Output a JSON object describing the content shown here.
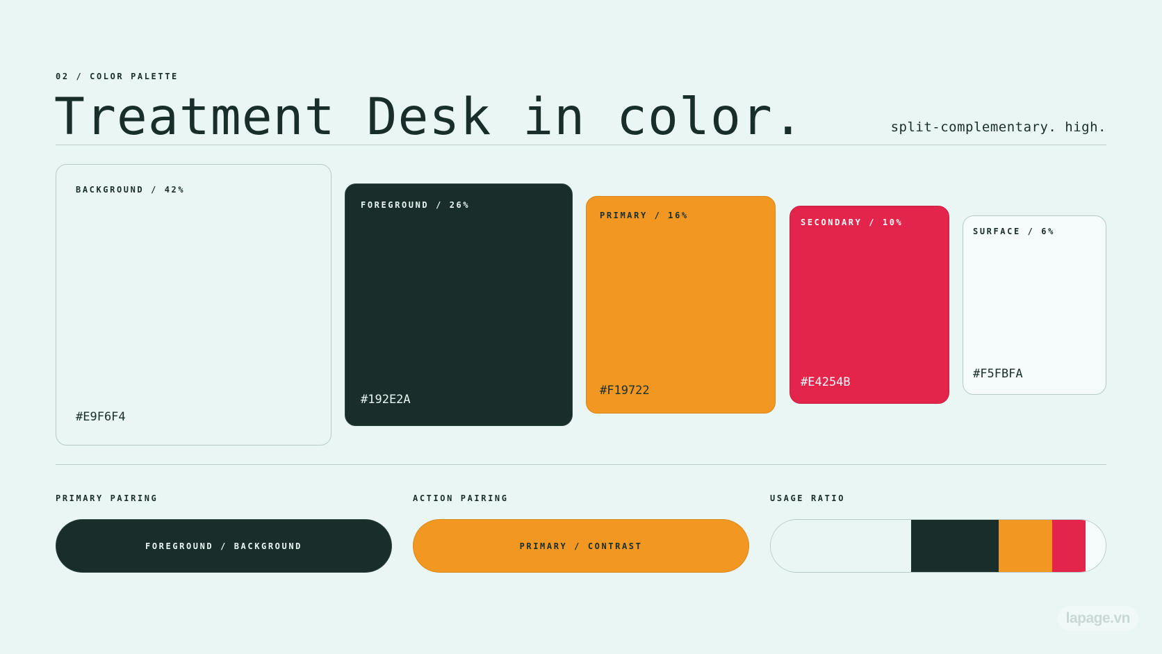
{
  "header": {
    "eyebrow": "02 / COLOR PALETTE",
    "title": "Treatment Desk in color.",
    "subtitle": "split-complementary. high."
  },
  "swatches": [
    {
      "label": "BACKGROUND / 42%",
      "hex": "#E9F6F4",
      "color": "#E9F6F4",
      "share": 42
    },
    {
      "label": "FOREGROUND / 26%",
      "hex": "#192E2A",
      "color": "#192E2A",
      "share": 26
    },
    {
      "label": "PRIMARY / 16%",
      "hex": "#F19722",
      "color": "#F19722",
      "share": 16
    },
    {
      "label": "SECONDARY / 10%",
      "hex": "#E4254B",
      "color": "#E4254B",
      "share": 10
    },
    {
      "label": "SURFACE / 6%",
      "hex": "#F5FBFA",
      "color": "#F5FBFA",
      "share": 6
    }
  ],
  "pairings": {
    "primary": {
      "heading": "PRIMARY PAIRING",
      "text": "FOREGROUND / BACKGROUND"
    },
    "action": {
      "heading": "ACTION PAIRING",
      "text": "PRIMARY / CONTRAST"
    },
    "usage": {
      "heading": "USAGE RATIO"
    }
  },
  "watermark": "lapage.vn"
}
